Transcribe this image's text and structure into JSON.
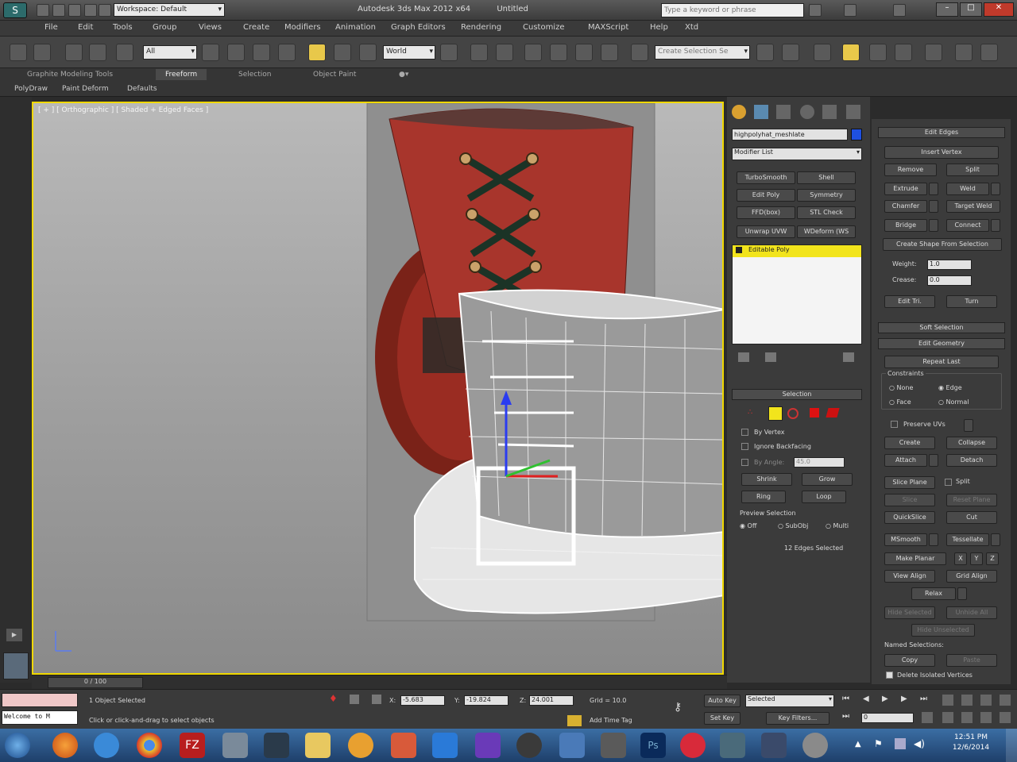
{
  "titlebar": {
    "workspace": "Workspace: Default",
    "title": "Autodesk 3ds Max 2012 x64",
    "file": "Untitled",
    "search_placeholder": "Type a keyword or phrase"
  },
  "menu": [
    "File",
    "Edit",
    "Tools",
    "Group",
    "Views",
    "Create",
    "Modifiers",
    "Animation",
    "Graph Editors",
    "Rendering",
    "Customize",
    "MAXScript",
    "Help",
    "Xtd"
  ],
  "toolbar": {
    "filter": "All",
    "refcoord": "World",
    "selset_placeholder": "Create Selection Se"
  },
  "ribbon": {
    "tabs": [
      "Graphite Modeling Tools",
      "Freeform",
      "Selection",
      "Object Paint"
    ],
    "subtabs": [
      "PolyDraw",
      "Paint Deform",
      "Defaults"
    ]
  },
  "viewport": {
    "label": "[ + ] [ Orthographic ] [ Shaded + Edged Faces ]"
  },
  "command_panel": {
    "object_name": "highpolyhat_meshlate",
    "modifier_list": "Modifier List",
    "modifier_buttons": [
      "TurboSmooth",
      "Shell",
      "Edit Poly",
      "Symmetry",
      "FFD(box)",
      "STL Check",
      "Unwrap UVW",
      "WDeform (WS"
    ],
    "stack_item": "Editable Poly",
    "selection_title": "Selection",
    "by_vertex": "By Vertex",
    "ignore_backfacing": "Ignore Backfacing",
    "by_angle": "By Angle:",
    "by_angle_value": "45.0",
    "shrink": "Shrink",
    "grow": "Grow",
    "ring": "Ring",
    "loop": "Loop",
    "preview_selection": "Preview Selection",
    "preview_options": [
      "Off",
      "SubObj",
      "Multi"
    ],
    "edges_selected": "12 Edges Selected"
  },
  "edit_edges": {
    "title": "Edit Edges",
    "insert_vertex": "Insert Vertex",
    "buttons": [
      "Remove",
      "Split",
      "Extrude",
      "Weld",
      "Chamfer",
      "Target Weld",
      "Bridge",
      "Connect"
    ],
    "create_shape": "Create Shape From Selection",
    "weight_label": "Weight:",
    "weight_value": "1.0",
    "crease_label": "Crease:",
    "crease_value": "0.0",
    "edit_tri": "Edit Tri.",
    "turn": "Turn"
  },
  "rollouts": {
    "soft_selection": "Soft Selection",
    "edit_geometry": "Edit Geometry",
    "repeat_last": "Repeat Last",
    "constraints": "Constraints",
    "constraint_options": [
      "None",
      "Edge",
      "Face",
      "Normal"
    ],
    "preserve_uvs": "Preserve UVs",
    "create": "Create",
    "collapse": "Collapse",
    "attach": "Attach",
    "detach": "Detach",
    "slice_plane": "Slice Plane",
    "split": "Split",
    "slice": "Slice",
    "reset_plane": "Reset Plane",
    "quickslice": "QuickSlice",
    "cut": "Cut",
    "msmooth": "MSmooth",
    "tessellate": "Tessellate",
    "make_planar": "Make Planar",
    "xyz": [
      "X",
      "Y",
      "Z"
    ],
    "view_align": "View Align",
    "grid_align": "Grid Align",
    "relax": "Relax",
    "hide_selected": "Hide Selected",
    "unhide_all": "Unhide All",
    "hide_unselected": "Hide Unselected",
    "named_selections": "Named Selections:",
    "copy": "Copy",
    "paste": "Paste",
    "delete_isolated": "Delete Isolated Vertices"
  },
  "timeslider": {
    "frame": "0 / 100"
  },
  "status": {
    "welcome": "Welcome to M",
    "objects_selected": "1 Object Selected",
    "prompt": "Click or click-and-drag to select objects",
    "x_label": "X:",
    "x": "-5.683",
    "y_label": "Y:",
    "y": "-19.824",
    "z_label": "Z:",
    "z": "24.001",
    "grid": "Grid = 10.0",
    "auto_key": "Auto Key",
    "set_key": "Set Key",
    "key_mode": "Selected",
    "key_filters": "Key Filters...",
    "add_time_tag": "Add Time Tag",
    "frame_field": "0"
  },
  "taskbar": {
    "time": "12:51 PM",
    "date": "12/6/2014"
  },
  "colors": {
    "viewport_border": "#f0d800",
    "stack_highlight": "#f2e41c",
    "hat_red": "#a8352c",
    "panel": "#3b3b3b"
  }
}
